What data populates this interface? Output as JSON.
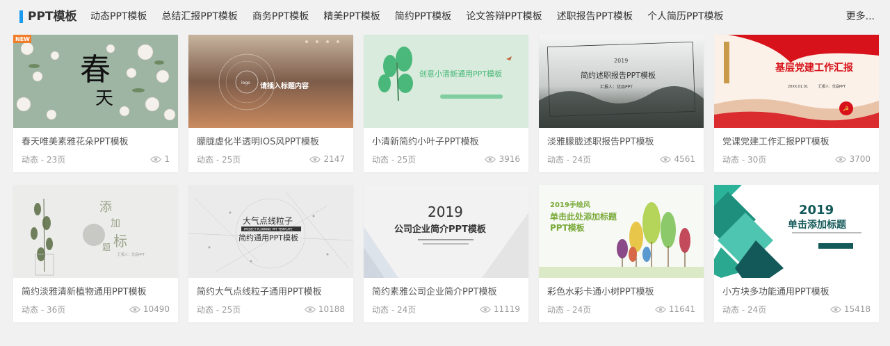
{
  "header": {
    "brand": "PPT模板",
    "nav": [
      "动态PPT模板",
      "总结汇报PPT模板",
      "商务PPT模板",
      "精美PPT模板",
      "简约PPT模板",
      "论文答辩PPT模板",
      "述职报告PPT模板",
      "个人简历PPT模板"
    ],
    "more": "更多..."
  },
  "cards": [
    {
      "title": "春天唯美素雅花朵PPT模板",
      "meta": "动态 - 23页",
      "views": "1",
      "thumb_text": [
        "春",
        "天"
      ],
      "badge": "NEW"
    },
    {
      "title": "朦胧虚化半透明IOS风PPT模板",
      "meta": "动态 - 25页",
      "views": "2147",
      "thumb_text": [
        "请插入标题内容",
        "logo"
      ]
    },
    {
      "title": "小清新简约小叶子PPT模板",
      "meta": "动态 - 25页",
      "views": "3916",
      "thumb_text": [
        "创意小清新通用PPT模板"
      ]
    },
    {
      "title": "淡雅朦胧述职报告PPT模板",
      "meta": "动态 - 24页",
      "views": "4561",
      "thumb_text": [
        "2019",
        "简约述职报告PPT模板",
        "汇报人：优品PPT"
      ]
    },
    {
      "title": "党课党建工作汇报PPT模板",
      "meta": "动态 - 30页",
      "views": "3700",
      "thumb_text": [
        "基层党建工作汇报",
        "20XX.01.01",
        "汇报人：优品PPT"
      ]
    },
    {
      "title": "简约淡雅清新植物通用PPT模板",
      "meta": "动态 - 36页",
      "views": "10490",
      "thumb_text": [
        "添",
        "加",
        "标",
        "题",
        "汇报人：优品PPT"
      ]
    },
    {
      "title": "简约大气点线粒子通用PPT模板",
      "meta": "动态 - 25页",
      "views": "10188",
      "thumb_text": [
        "大气点线粒子",
        "PROJECT PLANNING PPT TEMPLATE",
        "简约通用PPT模板"
      ]
    },
    {
      "title": "简约素雅公司企业简介PPT模板",
      "meta": "动态 - 24页",
      "views": "11119",
      "thumb_text": [
        "2019",
        "公司企业简介PPT模板"
      ]
    },
    {
      "title": "彩色水彩卡通小树PPT模板",
      "meta": "动态 - 24页",
      "views": "11641",
      "thumb_text": [
        "2019手绘风",
        "单击此处添加标题",
        "PPT模板"
      ]
    },
    {
      "title": "小方块多功能通用PPT模板",
      "meta": "动态 - 24页",
      "views": "15418",
      "thumb_text": [
        "2019",
        "单击添加标题"
      ]
    }
  ],
  "colors": {
    "accent": "#1a9bf0",
    "badge": "#f07d2a",
    "party_red": "#d7121a"
  }
}
